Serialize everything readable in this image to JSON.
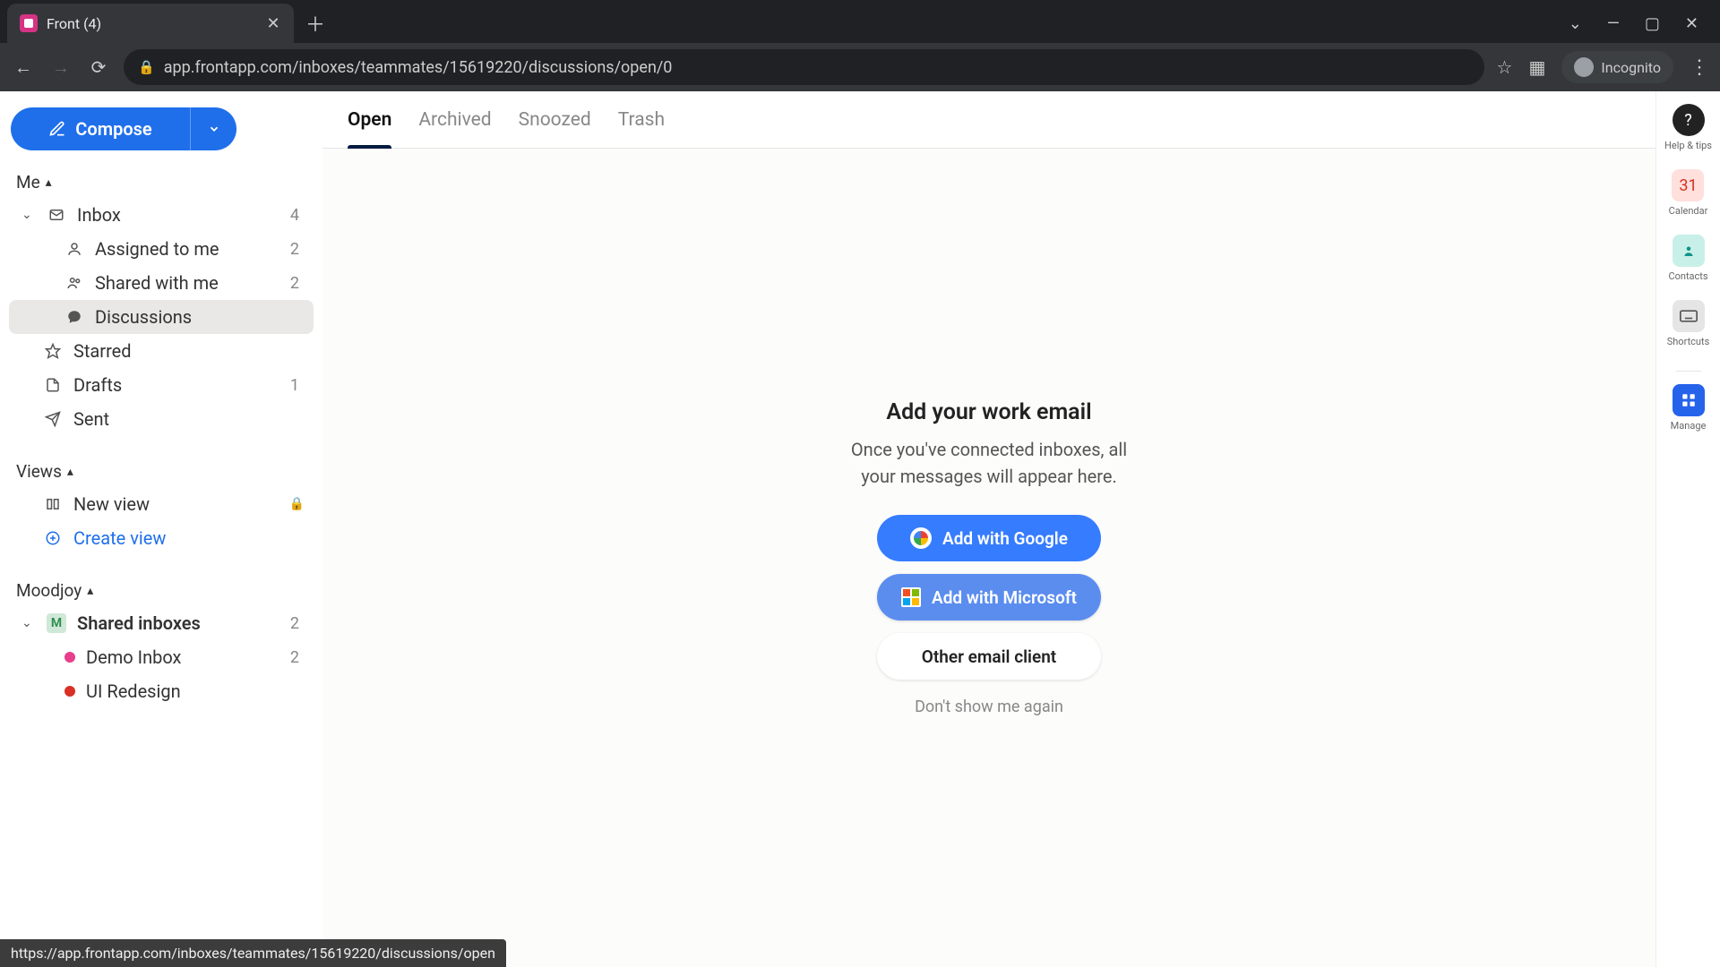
{
  "browser": {
    "tab_title": "Front (4)",
    "url_display": "app.frontapp.com/inboxes/teammates/15619220/discussions/open/0",
    "incognito_label": "Incognito",
    "status_url": "https://app.frontapp.com/inboxes/teammates/15619220/discussions/open"
  },
  "compose": {
    "label": "Compose"
  },
  "sections": {
    "me": {
      "label": "Me",
      "inbox": {
        "label": "Inbox",
        "count": "4"
      },
      "assigned": {
        "label": "Assigned to me",
        "count": "2"
      },
      "shared": {
        "label": "Shared with me",
        "count": "2"
      },
      "discussions": {
        "label": "Discussions"
      },
      "starred": {
        "label": "Starred"
      },
      "drafts": {
        "label": "Drafts",
        "count": "1"
      },
      "sent": {
        "label": "Sent"
      }
    },
    "views": {
      "label": "Views",
      "new_view": "New view",
      "create_view": "Create view"
    },
    "workspace": {
      "label": "Moodjoy",
      "badge": "M",
      "shared_inboxes": {
        "label": "Shared inboxes",
        "count": "2"
      },
      "demo": {
        "label": "Demo Inbox",
        "count": "2"
      },
      "ui": {
        "label": "UI Redesign"
      }
    }
  },
  "tabs": {
    "open": "Open",
    "archived": "Archived",
    "snoozed": "Snoozed",
    "trash": "Trash"
  },
  "empty": {
    "title": "Add your work email",
    "subtitle": "Once you've connected inboxes, all your messages will appear here.",
    "google": "Add with Google",
    "microsoft": "Add with Microsoft",
    "other": "Other email client",
    "dismiss": "Don't show me again"
  },
  "rail": {
    "help": "Help & tips",
    "calendar": "Calendar",
    "contacts": "Contacts",
    "shortcuts": "Shortcuts",
    "manage": "Manage"
  }
}
